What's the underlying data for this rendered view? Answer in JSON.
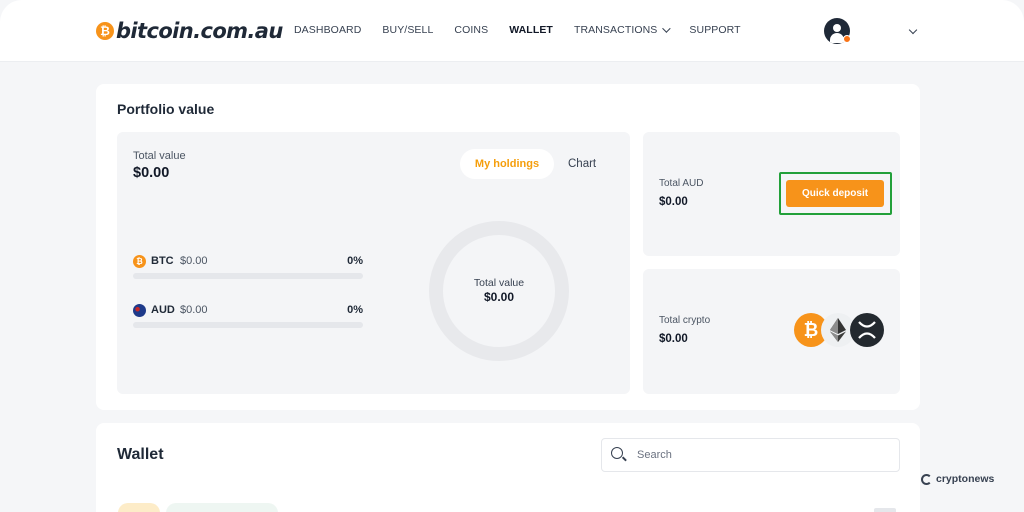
{
  "brand": {
    "name": "bitcoin.com.au",
    "coin_glyph": "₿",
    "accent": "#f7931a"
  },
  "nav": {
    "items": [
      {
        "label": "DASHBOARD"
      },
      {
        "label": "BUY/SELL"
      },
      {
        "label": "COINS"
      },
      {
        "label": "WALLET"
      },
      {
        "label": "TRANSACTIONS"
      },
      {
        "label": "SUPPORT"
      }
    ],
    "active": "WALLET"
  },
  "portfolio": {
    "title": "Portfolio value",
    "total_label": "Total value",
    "total_value": "$0.00",
    "tabs": {
      "holdings": "My holdings",
      "chart": "Chart"
    },
    "assets": [
      {
        "code": "BTC",
        "value": "$0.00",
        "percent": "0%",
        "fill": 0
      },
      {
        "code": "AUD",
        "value": "$0.00",
        "percent": "0%",
        "fill": 0
      }
    ],
    "donut": {
      "label": "Total value",
      "value": "$0.00"
    }
  },
  "aud_panel": {
    "label": "Total AUD",
    "value": "$0.00",
    "button": "Quick deposit",
    "highlight_color": "#22a03a"
  },
  "crypto_panel": {
    "label": "Total crypto",
    "icons": [
      "bitcoin-icon",
      "ethereum-icon",
      "xrp-icon"
    ]
  },
  "crypto_panel_value": "$0.00",
  "wallet": {
    "title": "Wallet",
    "search_placeholder": "Search"
  },
  "watermark": "cryptonews"
}
